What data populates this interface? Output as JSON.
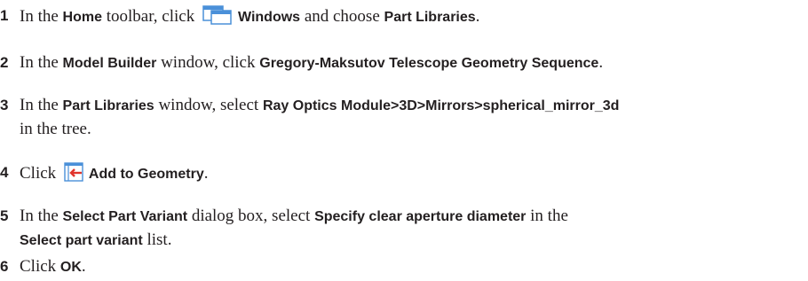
{
  "steps": [
    {
      "num": "1",
      "t1": "In the ",
      "b1": "Home",
      "t2": " toolbar, click ",
      "icon": "windows-icon",
      "b2": "Windows",
      "t3": " and choose ",
      "b3": "Part Libraries",
      "t4": "."
    },
    {
      "num": "2",
      "t1": "In the ",
      "b1": "Model Builder",
      "t2": " window, click ",
      "b2": "Gregory-Maksutov Telescope Geometry Sequence",
      "t3": "."
    },
    {
      "num": "3",
      "t1": "In the ",
      "b1": "Part Libraries",
      "t2": " window, select ",
      "b2": "Ray Optics Module>3D>Mirrors>spherical_mirror_3d",
      "line2": "in the tree."
    },
    {
      "num": "4",
      "t1": "Click ",
      "icon": "add-to-geometry-icon",
      "b1": "Add to Geometry",
      "t2": "."
    },
    {
      "num": "5",
      "t1": "In the ",
      "b1": "Select Part Variant",
      "t2": " dialog box, select ",
      "b2": "Specify clear aperture diameter",
      "t3": " in the",
      "line2_b": "Select part variant",
      "line2_t": " list."
    },
    {
      "num": "6",
      "t1": "Click ",
      "b1": "OK",
      "t2": "."
    }
  ],
  "colors": {
    "text": "#231f20",
    "icon_blue": "#4a90d9",
    "icon_red": "#e0332b"
  }
}
